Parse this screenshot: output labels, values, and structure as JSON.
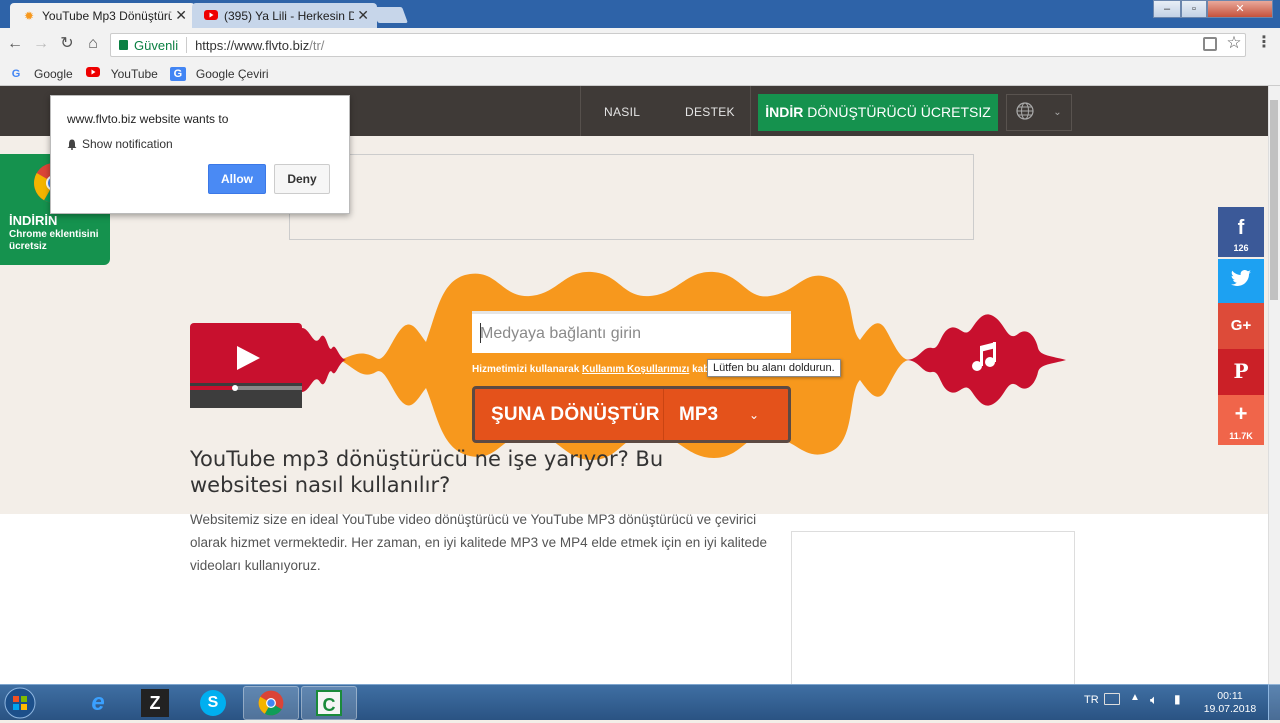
{
  "browser": {
    "tabs": [
      {
        "title": "YouTube Mp3 Dönüştürü",
        "active": true
      },
      {
        "title": "(395) Ya Lili - Herkesin D",
        "active": false
      }
    ],
    "window_controls": [
      "–",
      "▫",
      "✕"
    ],
    "security_label": "Güvenli",
    "url_host": "https://www.flvto.biz",
    "url_path": "/tr/",
    "bookmarks": [
      "Google",
      "YouTube",
      "Google Çeviri"
    ]
  },
  "site": {
    "nav": {
      "how": "NASIL",
      "support": "DESTEK"
    },
    "download_bold": "İNDİR",
    "download_rest": " DÖNÜŞTÜRÜCÜ ÜCRETSIZ",
    "chrome_promo": {
      "title": "İNDİRİN",
      "subtitle": "Chrome eklentisini ücretsiz"
    },
    "converter": {
      "placeholder": "Medyaya bağlantı girin",
      "terms_prefix": "Hizmetimizi kullanarak ",
      "terms_link": "Kullanım Koşullarımızı",
      "terms_suffix": " kabul e",
      "tooltip": "Lütfen bu alanı doldurun.",
      "convert_label": "ŞUNA DÖNÜŞTÜR",
      "format": "MP3"
    },
    "social": {
      "facebook_count": "126",
      "plus_count": "11.7K"
    },
    "article": {
      "title": "YouTube mp3 dönüştürücü ne işe yarıyor? Bu websitesi nasıl kullanılır?",
      "body": "Websitemiz size en ideal YouTube video dönüştürücü ve YouTube MP3 dönüştürücü ve çevirici olarak hizmet vermektedir. Her zaman, en iyi kalitede MP3 ve MP4 elde etmek için en iyi kalitede videoları kullanıyoruz."
    }
  },
  "notification": {
    "message": "www.flvto.biz website wants to",
    "item": "Show notification",
    "allow": "Allow",
    "deny": "Deny"
  },
  "taskbar": {
    "language": "TR",
    "time": "00:11",
    "date": "19.07.2018"
  },
  "colors": {
    "orange": "#f7981d",
    "red": "#c8102e",
    "green": "#15924e",
    "dark_nav": "#3f3a37",
    "convert": "#e4521b"
  }
}
